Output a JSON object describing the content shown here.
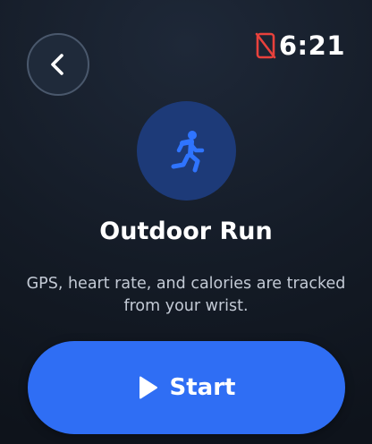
{
  "status": {
    "time": "6:21",
    "phone_disconnected_icon": "phone-disconnected-icon",
    "alert_color": "#e8413c"
  },
  "nav": {
    "back_icon": "chevron-left-icon"
  },
  "activity": {
    "icon": "running-person-icon",
    "icon_color": "#2f74ff",
    "badge_color": "#1d3a78",
    "title": "Outdoor Run",
    "description": "GPS, heart rate, and calories are tracked from your wrist."
  },
  "start": {
    "label": "Start",
    "icon": "play-icon",
    "color": "#2f6ef4"
  }
}
